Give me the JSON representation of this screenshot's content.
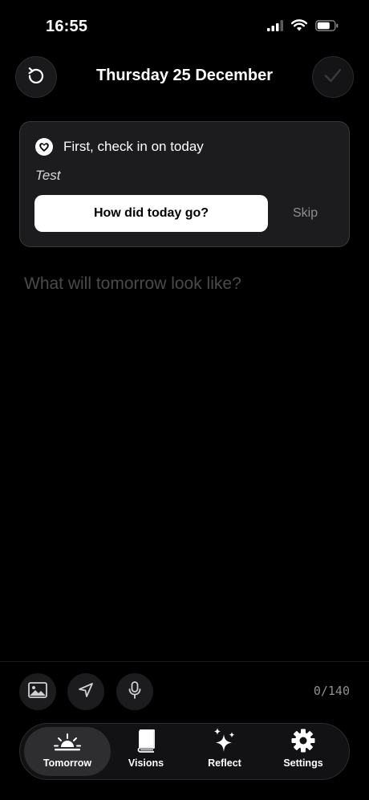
{
  "status": {
    "time": "16:55"
  },
  "header": {
    "title": "Thursday 25 December"
  },
  "checkin": {
    "title": "First, check in on today",
    "note": "Test",
    "primary_label": "How did today go?",
    "skip_label": "Skip"
  },
  "entry": {
    "placeholder": "What will tomorrow look like?"
  },
  "toolbar": {
    "char_count": "0/140"
  },
  "tabs": [
    {
      "label": "Tomorrow",
      "icon": "sunrise-icon",
      "active": true
    },
    {
      "label": "Visions",
      "icon": "book-icon",
      "active": false
    },
    {
      "label": "Reflect",
      "icon": "sparkles-icon",
      "active": false
    },
    {
      "label": "Settings",
      "icon": "gear-icon",
      "active": false
    }
  ],
  "colors": {
    "background": "#000000",
    "card": "#1c1c1e",
    "muted": "#8e8e93",
    "accent": "#ffffff"
  }
}
